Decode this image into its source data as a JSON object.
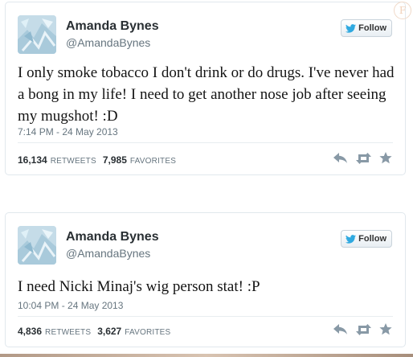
{
  "brand": {
    "twitter_blue": "#2fa9e0"
  },
  "tweets": [
    {
      "name": "Amanda Bynes",
      "handle": "@AmandaBynes",
      "follow_label": "Follow",
      "text": "I only smoke tobacco I don't drink or do drugs. I've never had a bong in my life! I need to get another nose job after seeing my mugshot! :D",
      "timestamp": "7:14 PM - 24 May 2013",
      "retweets": "16,134",
      "retweets_label": "RETWEETS",
      "favorites": "7,985",
      "favorites_label": "FAVORITES",
      "actions": [
        "reply-icon",
        "retweet-icon",
        "favorite-icon"
      ]
    },
    {
      "name": "Amanda Bynes",
      "handle": "@AmandaBynes",
      "follow_label": "Follow",
      "text": "I need Nicki Minaj's wig person stat! :P",
      "timestamp": "10:04 PM - 24 May 2013",
      "retweets": "4,836",
      "retweets_label": "RETWEETS",
      "favorites": "3,627",
      "favorites_label": "FAVORITES",
      "actions": [
        "reply-icon",
        "retweet-icon",
        "favorite-icon"
      ]
    }
  ]
}
